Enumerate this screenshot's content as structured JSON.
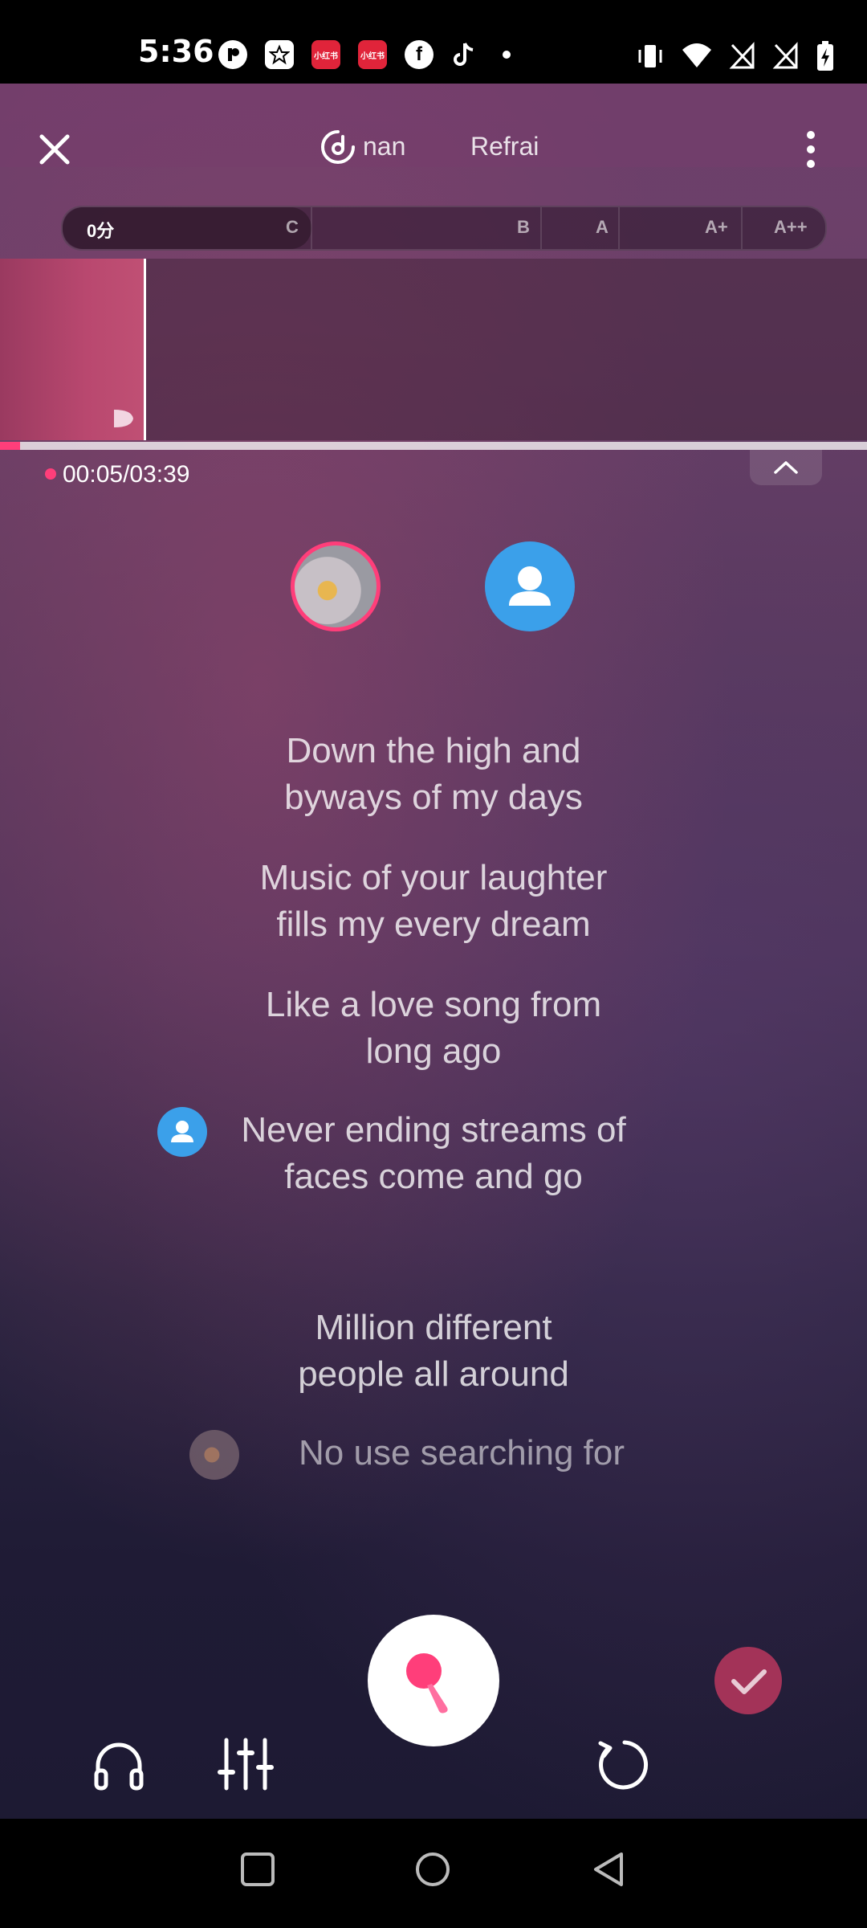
{
  "status_bar": {
    "time": "5:36",
    "notification_icons": [
      "app-icon",
      "star-app-icon",
      "xiaohongshu-icon",
      "xiaohongshu-icon",
      "facebook-icon",
      "tiktok-icon",
      "dot-icon"
    ],
    "xiaohongshu_label": "小红书",
    "system_icons": [
      "vibrate-icon",
      "wifi-icon",
      "no-signal-icon",
      "no-signal-icon",
      "battery-charging-icon"
    ]
  },
  "header": {
    "tabs": [
      {
        "label": "nan",
        "icon": "sing-mode-icon"
      },
      {
        "label": "Refrai"
      }
    ]
  },
  "score": {
    "value": "0分",
    "grades": [
      "C",
      "B",
      "A",
      "A+",
      "A++"
    ]
  },
  "playback": {
    "elapsed": "00:05",
    "total": "03:39",
    "display": "00:05/03:39",
    "progress_fraction": 0.023
  },
  "lyrics": [
    {
      "line1": "Down the high and",
      "line2": "byways of my days",
      "singer": null
    },
    {
      "line1": "Music of your laughter",
      "line2": "fills my every dream",
      "singer": null
    },
    {
      "line1": "Like a love song from",
      "line2": "long ago",
      "singer": null
    },
    {
      "line1": "Never ending streams of",
      "line2": "faces come and go",
      "singer": "partner"
    },
    {
      "line1": "Million different",
      "line2": "people all around",
      "singer": null
    },
    {
      "line1": "No use searching for",
      "line2": "",
      "singer": "me"
    }
  ],
  "controls": {
    "icons": [
      "headphones-icon",
      "equalizer-icon",
      "microphone-icon",
      "retry-icon",
      "check-icon"
    ]
  },
  "colors": {
    "accent": "#ff3e7a",
    "partner_blue": "#3ba0ea",
    "done_button": "#a33358"
  }
}
